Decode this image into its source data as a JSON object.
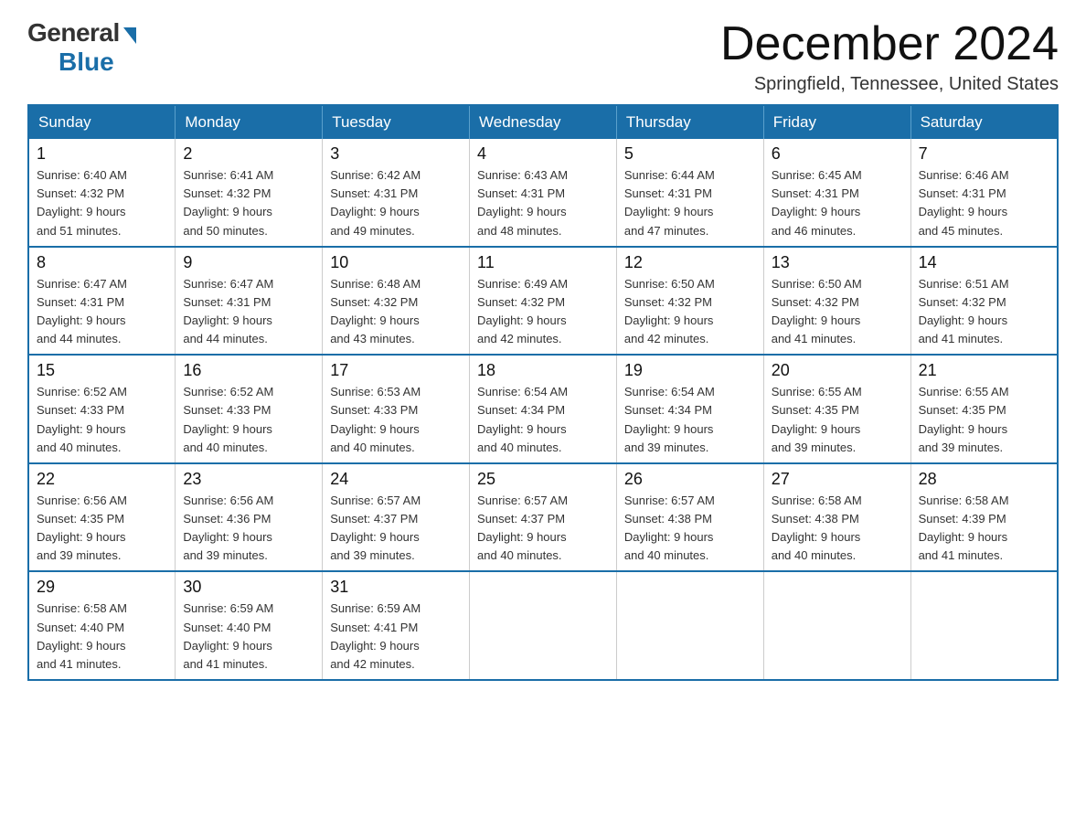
{
  "logo": {
    "general": "General",
    "blue": "Blue"
  },
  "title": {
    "month_year": "December 2024",
    "location": "Springfield, Tennessee, United States"
  },
  "header_days": [
    "Sunday",
    "Monday",
    "Tuesday",
    "Wednesday",
    "Thursday",
    "Friday",
    "Saturday"
  ],
  "weeks": [
    [
      {
        "day": "1",
        "sunrise": "6:40 AM",
        "sunset": "4:32 PM",
        "daylight": "9 hours and 51 minutes."
      },
      {
        "day": "2",
        "sunrise": "6:41 AM",
        "sunset": "4:32 PM",
        "daylight": "9 hours and 50 minutes."
      },
      {
        "day": "3",
        "sunrise": "6:42 AM",
        "sunset": "4:31 PM",
        "daylight": "9 hours and 49 minutes."
      },
      {
        "day": "4",
        "sunrise": "6:43 AM",
        "sunset": "4:31 PM",
        "daylight": "9 hours and 48 minutes."
      },
      {
        "day": "5",
        "sunrise": "6:44 AM",
        "sunset": "4:31 PM",
        "daylight": "9 hours and 47 minutes."
      },
      {
        "day": "6",
        "sunrise": "6:45 AM",
        "sunset": "4:31 PM",
        "daylight": "9 hours and 46 minutes."
      },
      {
        "day": "7",
        "sunrise": "6:46 AM",
        "sunset": "4:31 PM",
        "daylight": "9 hours and 45 minutes."
      }
    ],
    [
      {
        "day": "8",
        "sunrise": "6:47 AM",
        "sunset": "4:31 PM",
        "daylight": "9 hours and 44 minutes."
      },
      {
        "day": "9",
        "sunrise": "6:47 AM",
        "sunset": "4:31 PM",
        "daylight": "9 hours and 44 minutes."
      },
      {
        "day": "10",
        "sunrise": "6:48 AM",
        "sunset": "4:32 PM",
        "daylight": "9 hours and 43 minutes."
      },
      {
        "day": "11",
        "sunrise": "6:49 AM",
        "sunset": "4:32 PM",
        "daylight": "9 hours and 42 minutes."
      },
      {
        "day": "12",
        "sunrise": "6:50 AM",
        "sunset": "4:32 PM",
        "daylight": "9 hours and 42 minutes."
      },
      {
        "day": "13",
        "sunrise": "6:50 AM",
        "sunset": "4:32 PM",
        "daylight": "9 hours and 41 minutes."
      },
      {
        "day": "14",
        "sunrise": "6:51 AM",
        "sunset": "4:32 PM",
        "daylight": "9 hours and 41 minutes."
      }
    ],
    [
      {
        "day": "15",
        "sunrise": "6:52 AM",
        "sunset": "4:33 PM",
        "daylight": "9 hours and 40 minutes."
      },
      {
        "day": "16",
        "sunrise": "6:52 AM",
        "sunset": "4:33 PM",
        "daylight": "9 hours and 40 minutes."
      },
      {
        "day": "17",
        "sunrise": "6:53 AM",
        "sunset": "4:33 PM",
        "daylight": "9 hours and 40 minutes."
      },
      {
        "day": "18",
        "sunrise": "6:54 AM",
        "sunset": "4:34 PM",
        "daylight": "9 hours and 40 minutes."
      },
      {
        "day": "19",
        "sunrise": "6:54 AM",
        "sunset": "4:34 PM",
        "daylight": "9 hours and 39 minutes."
      },
      {
        "day": "20",
        "sunrise": "6:55 AM",
        "sunset": "4:35 PM",
        "daylight": "9 hours and 39 minutes."
      },
      {
        "day": "21",
        "sunrise": "6:55 AM",
        "sunset": "4:35 PM",
        "daylight": "9 hours and 39 minutes."
      }
    ],
    [
      {
        "day": "22",
        "sunrise": "6:56 AM",
        "sunset": "4:35 PM",
        "daylight": "9 hours and 39 minutes."
      },
      {
        "day": "23",
        "sunrise": "6:56 AM",
        "sunset": "4:36 PM",
        "daylight": "9 hours and 39 minutes."
      },
      {
        "day": "24",
        "sunrise": "6:57 AM",
        "sunset": "4:37 PM",
        "daylight": "9 hours and 39 minutes."
      },
      {
        "day": "25",
        "sunrise": "6:57 AM",
        "sunset": "4:37 PM",
        "daylight": "9 hours and 40 minutes."
      },
      {
        "day": "26",
        "sunrise": "6:57 AM",
        "sunset": "4:38 PM",
        "daylight": "9 hours and 40 minutes."
      },
      {
        "day": "27",
        "sunrise": "6:58 AM",
        "sunset": "4:38 PM",
        "daylight": "9 hours and 40 minutes."
      },
      {
        "day": "28",
        "sunrise": "6:58 AM",
        "sunset": "4:39 PM",
        "daylight": "9 hours and 41 minutes."
      }
    ],
    [
      {
        "day": "29",
        "sunrise": "6:58 AM",
        "sunset": "4:40 PM",
        "daylight": "9 hours and 41 minutes."
      },
      {
        "day": "30",
        "sunrise": "6:59 AM",
        "sunset": "4:40 PM",
        "daylight": "9 hours and 41 minutes."
      },
      {
        "day": "31",
        "sunrise": "6:59 AM",
        "sunset": "4:41 PM",
        "daylight": "9 hours and 42 minutes."
      },
      null,
      null,
      null,
      null
    ]
  ],
  "labels": {
    "sunrise": "Sunrise:",
    "sunset": "Sunset:",
    "daylight": "Daylight:"
  }
}
